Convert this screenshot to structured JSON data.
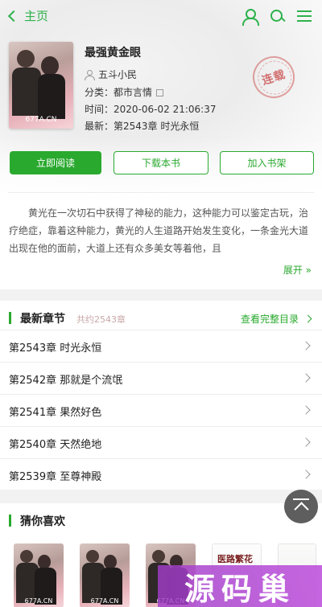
{
  "header": {
    "back_label": "主页"
  },
  "book": {
    "title": "最强黄金眼",
    "author": "五斗小民",
    "category_label": "分类：",
    "category": "都市言情",
    "time_label": "时间：",
    "time": "2020-06-02 21:06:37",
    "latest_label": "最新：",
    "latest": "第2543章 时光永恒",
    "status_stamp": "连载",
    "cover_watermark": "677A.CN"
  },
  "actions": {
    "read": "立即阅读",
    "download": "下载本书",
    "shelf": "加入书架"
  },
  "intro": {
    "text": "黄光在一次切石中获得了神秘的能力，这种能力可以鉴定古玩，治疗绝症，靠着这种能力，黄光的人生道路开始发生变化，一条金光大道出现在他的面前，大道上还有众多美女等着他，且",
    "expand": "展开"
  },
  "latest_chapters": {
    "title": "最新章节",
    "count": "共约2543章",
    "more": "查看完整目录",
    "items": [
      "第2543章 时光永恒",
      "第2542章 那就是个流氓",
      "第2541章 果然好色",
      "第2540章 天然绝地",
      "第2539章 至尊神殿"
    ]
  },
  "guess": {
    "title": "猜你喜欢",
    "cover_watermark": "677A.CN",
    "alt_cover_text": "医路繁花"
  },
  "watermark": "源码巢",
  "colors": {
    "accent": "#2aa92f",
    "fab": "#5e5e5e",
    "watermark": "#b45ad8"
  }
}
